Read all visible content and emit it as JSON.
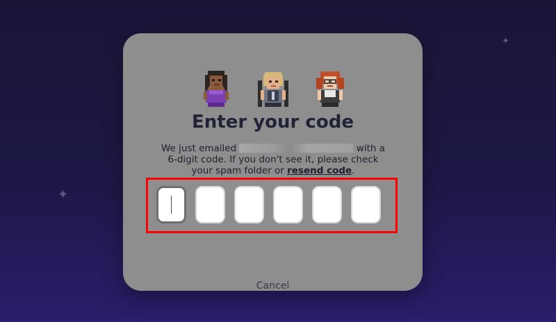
{
  "dialog": {
    "title": "Enter your code",
    "description_before": "We just emailed",
    "description_after": "with a 6-digit code. If you don't see it, please check your spam folder or",
    "resend_label": "resend code",
    "period": ".",
    "cancel_label": "Cancel"
  },
  "avatars": [
    {
      "name": "dark-haired-purple-dress-avatar",
      "icon": "pixel-avatar-woman-purple"
    },
    {
      "name": "blonde-armored-avatar",
      "icon": "pixel-avatar-man-armored"
    },
    {
      "name": "redhead-glasses-avatar",
      "icon": "pixel-avatar-woman-redhead"
    }
  ],
  "code_input": {
    "length": 6,
    "values": [
      "",
      "",
      "",
      "",
      "",
      ""
    ],
    "active_index": 0
  },
  "colors": {
    "background_top": "#1a1638",
    "background_bottom": "#2a1d6a",
    "modal": "#8e8e8e",
    "title": "#232337",
    "highlight": "#ff0000"
  }
}
